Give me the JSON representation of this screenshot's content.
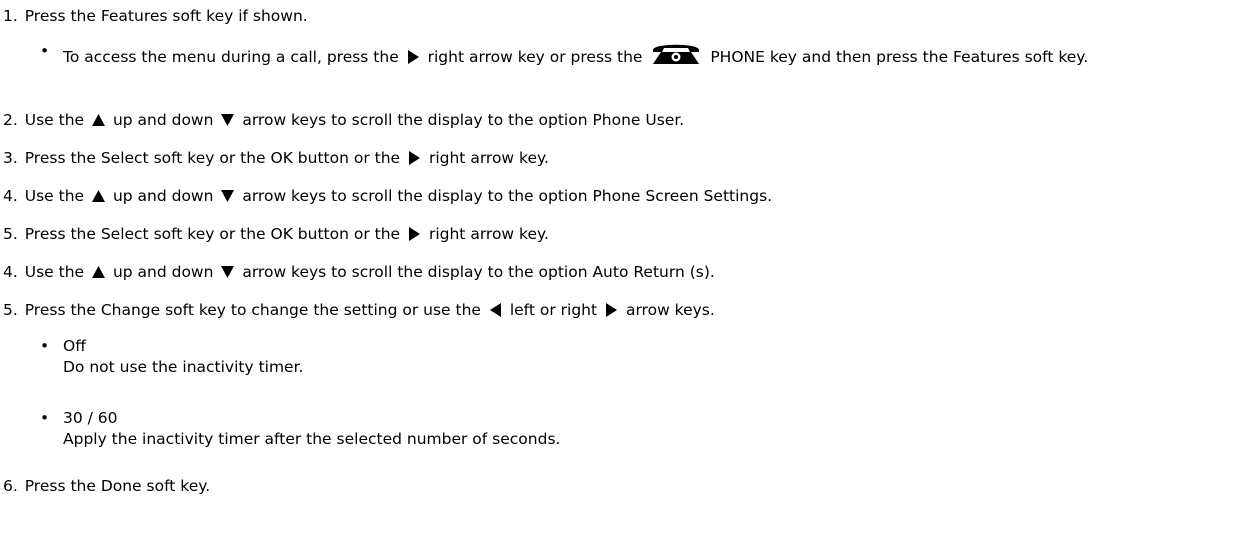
{
  "bullet_char": "•",
  "steps": [
    {
      "num": "1.",
      "parts": [
        "Press the Features soft key if shown."
      ]
    },
    {
      "num": "2.",
      "parts": [
        "Use the",
        "up and down",
        "arrow keys to scroll the display to the option Phone User."
      ]
    },
    {
      "num": "3.",
      "parts": [
        "Press the Select soft key or the OK button or the",
        "right arrow key."
      ]
    },
    {
      "num": "4.",
      "parts": [
        "Use the",
        "up and down",
        "arrow keys to scroll the display to the option Phone Screen Settings."
      ]
    },
    {
      "num": "5.",
      "parts": [
        "Press the Select soft key or the OK button or the",
        "right arrow key."
      ]
    },
    {
      "num": "4.",
      "parts": [
        "Use the",
        "up and down",
        "arrow keys to scroll the display to the option Auto Return (s)."
      ]
    },
    {
      "num": "5.",
      "parts": [
        "Press the Change soft key to change the setting or use the",
        "left or right",
        "arrow keys."
      ]
    },
    {
      "num": "6.",
      "parts": [
        "Press the Done soft key."
      ]
    }
  ],
  "call_bullet": {
    "parts": [
      "To access the menu during a call, press the",
      "right arrow key or press the",
      "PHONE key and then press the Features soft key."
    ]
  },
  "options": [
    {
      "label": "Off",
      "description": "Do not use the inactivity timer."
    },
    {
      "label": "30 / 60",
      "description": "Apply the inactivity timer after the selected number of seconds."
    }
  ],
  "icons": {
    "arrow_right": "right-arrow-key-icon",
    "arrow_left": "left-arrow-key-icon",
    "arrow_up": "up-arrow-key-icon",
    "arrow_down": "down-arrow-key-icon",
    "phone": "phone-key-icon"
  }
}
